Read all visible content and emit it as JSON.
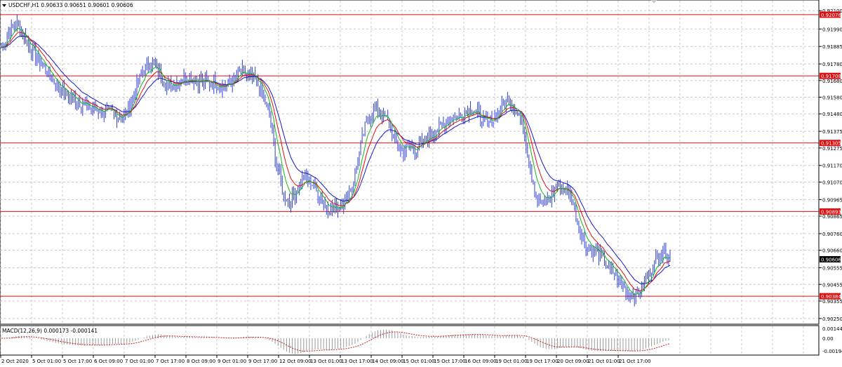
{
  "main": {
    "symbol_label": "USDCHF,H1  0.90633 0.90651 0.90601 0.90606"
  },
  "macd": {
    "label": "MACD(12,26,9) 0.000173 -0.000141",
    "axis_ticks": [
      "0.001444",
      "0.00",
      "-0.001949"
    ]
  },
  "colors": {
    "candles": "#2e3fd0",
    "ma_fast": "#17b617",
    "ma_mid": "#e01010",
    "ma_slow": "#1818c8",
    "hlines": "#e01010",
    "grid": "#c8c8c8",
    "macd_hist": "#9a9a9a",
    "macd_signal": "#c82020"
  },
  "chart_data": [
    {
      "type": "line",
      "title": "USDCHF,H1",
      "ohlc_last": {
        "open": 0.90633,
        "high": 0.90651,
        "low": 0.90601,
        "close": 0.90606
      },
      "y_ticks": [
        "0.92100",
        "0.91990",
        "0.91885",
        "0.91780",
        "0.91680",
        "0.91580",
        "0.91480",
        "0.91375",
        "0.91275",
        "0.91170",
        "0.91070",
        "0.90965",
        "0.90865",
        "0.90760",
        "0.90660",
        "0.90555",
        "0.90455",
        "0.90355",
        "0.90250"
      ],
      "ylim": [
        0.9022,
        0.9216
      ],
      "x_ticks": [
        "2 Oct 2020",
        "5 Oct 01:00",
        "5 Oct 17:00",
        "6 Oct 09:00",
        "7 Oct 01:00",
        "7 Oct 17:00",
        "8 Oct 09:00",
        "9 Oct 01:00",
        "9 Oct 17:00",
        "12 Oct 09:00",
        "13 Oct 01:00",
        "13 Oct 17:00",
        "14 Oct 09:00",
        "15 Oct 01:00",
        "15 Oct 17:00",
        "16 Oct 09:00",
        "19 Oct 01:00",
        "19 Oct 17:00",
        "20 Oct 09:00",
        "21 Oct 01:00",
        "21 Oct 17:00"
      ],
      "horizontal_levels": [
        "0.92076",
        "0.91708",
        "0.91305",
        "0.90893",
        "0.90384"
      ],
      "current_price": "0.90606",
      "price_path": [
        0.9188,
        0.9196,
        0.9203,
        0.9196,
        0.9188,
        0.9182,
        0.9176,
        0.917,
        0.9165,
        0.916,
        0.9158,
        0.9155,
        0.9153,
        0.9151,
        0.915,
        0.9149,
        0.9148,
        0.9145,
        0.915,
        0.9163,
        0.9173,
        0.9178,
        0.9176,
        0.9168,
        0.9164,
        0.9167,
        0.917,
        0.917,
        0.9168,
        0.9167,
        0.9167,
        0.9165,
        0.9165,
        0.9168,
        0.9174,
        0.9171,
        0.9168,
        0.9162,
        0.9148,
        0.912,
        0.91,
        0.9095,
        0.9103,
        0.911,
        0.9107,
        0.91,
        0.9093,
        0.909,
        0.9093,
        0.9097,
        0.9106,
        0.9128,
        0.9146,
        0.915,
        0.9148,
        0.9143,
        0.913,
        0.9125,
        0.9128,
        0.9127,
        0.9131,
        0.9136,
        0.9139,
        0.9143,
        0.9147,
        0.9146,
        0.915,
        0.9151,
        0.9146,
        0.9142,
        0.9145,
        0.9152,
        0.9157,
        0.9152,
        0.9142,
        0.9118,
        0.9098,
        0.9093,
        0.9098,
        0.9106,
        0.9103,
        0.9098,
        0.908,
        0.9068,
        0.9066,
        0.9063,
        0.9057,
        0.9052,
        0.9047,
        0.904,
        0.9038,
        0.9043,
        0.9052,
        0.906,
        0.9066,
        0.9062
      ]
    },
    {
      "type": "bar",
      "title": "MACD(12,26,9)",
      "values_label": "0.000173 -0.000141",
      "y_ticks": [
        "0.001444",
        "0.00",
        "-0.001949"
      ]
    }
  ]
}
